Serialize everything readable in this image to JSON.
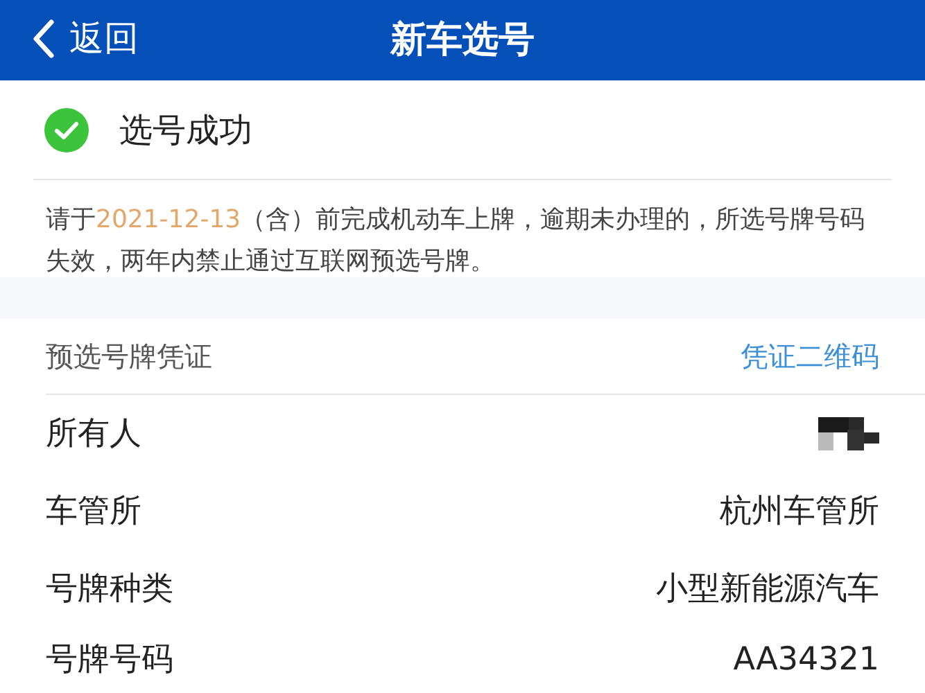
{
  "nav_bar": {
    "back_label": "返回",
    "title": "新车选号"
  },
  "result": {
    "success": true,
    "text": "选号成功"
  },
  "notice": [
    {
      "kind": "plain",
      "text": "请于"
    },
    {
      "kind": "date",
      "text": "2021-12-13"
    },
    {
      "kind": "plain",
      "text": "（含）前完成机动车上牌，逾期未办理的，所选号牌号码失效，两年内禁止通过互联网预选号牌。"
    }
  ],
  "voucher": {
    "title": "预选号牌凭证",
    "link": "凭证二维码",
    "rows": [
      {
        "label": "所有人",
        "kind": "redacted"
      },
      {
        "label": "车管所",
        "kind": "text",
        "value": "杭州车管所"
      },
      {
        "label": "号牌种类",
        "kind": "text",
        "value": "小型新能源汽车"
      },
      {
        "label": "号牌号码",
        "kind": "text",
        "value": "AA34321"
      }
    ]
  }
}
